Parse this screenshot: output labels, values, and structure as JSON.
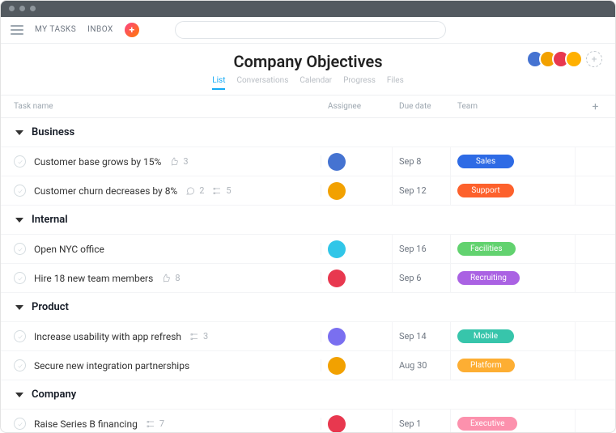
{
  "nav": {
    "mytasks": "MY TASKS",
    "inbox": "INBOX"
  },
  "search": {
    "placeholder": ""
  },
  "header": {
    "title": "Company Objectives",
    "avatars": [
      {
        "bg": "#4573d1"
      },
      {
        "bg": "#f2a100"
      },
      {
        "bg": "#e8384f"
      },
      {
        "bg": "#ffb000"
      }
    ]
  },
  "tabs": [
    {
      "label": "List",
      "active": true
    },
    {
      "label": "Conversations",
      "active": false
    },
    {
      "label": "Calendar",
      "active": false
    },
    {
      "label": "Progress",
      "active": false
    },
    {
      "label": "Files",
      "active": false
    }
  ],
  "columns": {
    "name": "Task name",
    "assignee": "Assignee",
    "due": "Due date",
    "team": "Team"
  },
  "teamColors": {
    "Sales": "#2e6be5",
    "Support": "#fd612c",
    "Facilities": "#62d26f",
    "Recruiting": "#aa62e3",
    "Mobile": "#37c5ab",
    "Platform": "#fdae33",
    "Executive": "#fc91ad"
  },
  "sections": [
    {
      "name": "Business",
      "tasks": [
        {
          "title": "Customer base grows by 15%",
          "likes": 3,
          "comments": null,
          "subtasks": null,
          "assigneeColor": "#4573d1",
          "due": "Sep 8",
          "team": "Sales"
        },
        {
          "title": "Customer churn decreases by 8%",
          "likes": null,
          "comments": 2,
          "subtasks": 5,
          "assigneeColor": "#f2a100",
          "due": "Sep 12",
          "team": "Support"
        }
      ]
    },
    {
      "name": "Internal",
      "tasks": [
        {
          "title": "Open NYC office",
          "likes": null,
          "comments": null,
          "subtasks": null,
          "assigneeColor": "#31c6e8",
          "due": "Sep 16",
          "team": "Facilities"
        },
        {
          "title": "Hire 18 new team members",
          "likes": 8,
          "comments": null,
          "subtasks": null,
          "assigneeColor": "#e8384f",
          "due": "Sep 6",
          "team": "Recruiting"
        }
      ]
    },
    {
      "name": "Product",
      "tasks": [
        {
          "title": "Increase usability with app refresh",
          "likes": null,
          "comments": null,
          "subtasks": 3,
          "assigneeColor": "#7a6ff0",
          "due": "Sep 14",
          "team": "Mobile"
        },
        {
          "title": "Secure new integration partnerships",
          "likes": null,
          "comments": null,
          "subtasks": null,
          "assigneeColor": "#f2a100",
          "due": "Aug 30",
          "team": "Platform"
        }
      ]
    },
    {
      "name": "Company",
      "tasks": [
        {
          "title": "Raise Series B financing",
          "likes": null,
          "comments": null,
          "subtasks": 7,
          "assigneeColor": "#e8384f",
          "due": "Sep 1",
          "team": "Executive"
        }
      ]
    }
  ]
}
